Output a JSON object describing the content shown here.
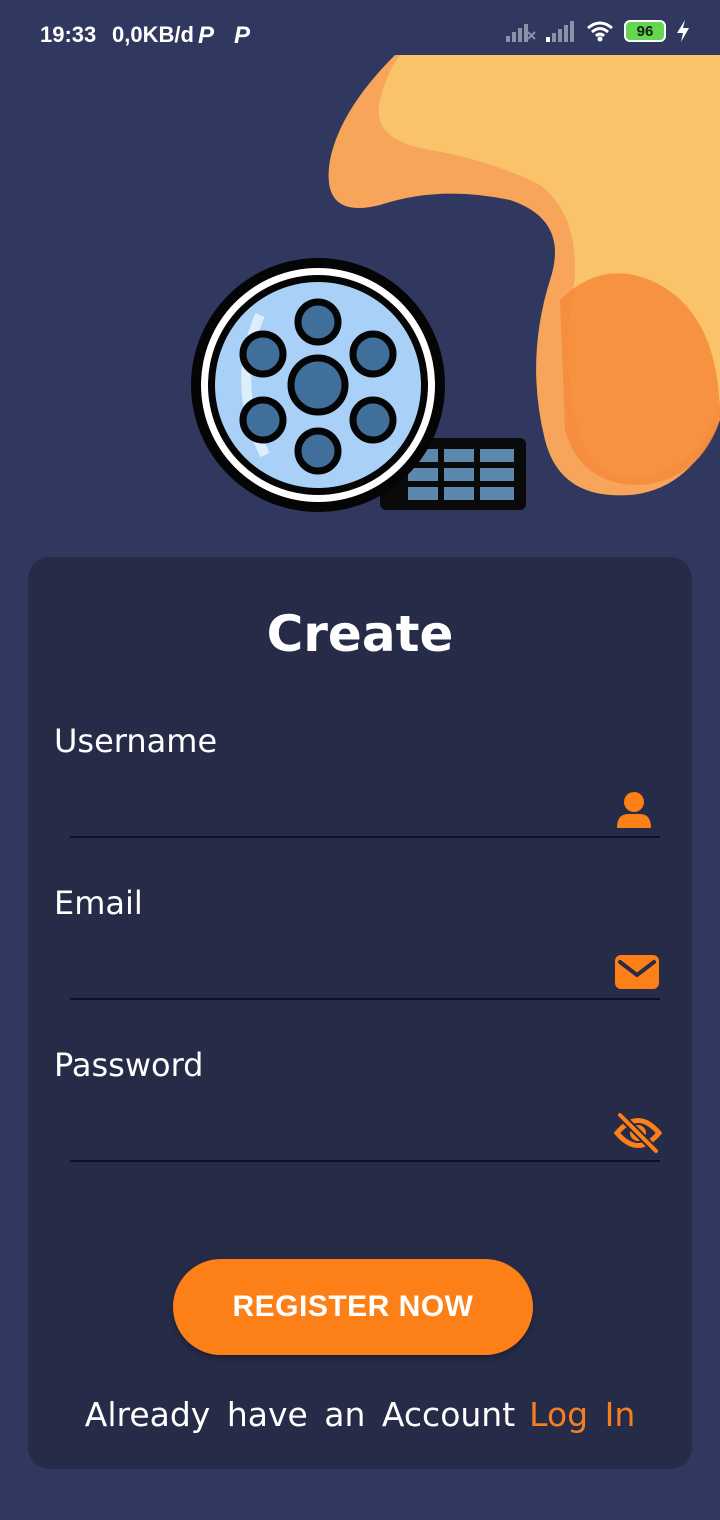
{
  "status_bar": {
    "time": "19:33",
    "data_speed": "0,0KB/d",
    "notification_icons": [
      "P",
      "P"
    ],
    "battery_level": "96"
  },
  "register_form": {
    "title": "Create",
    "fields": [
      {
        "label": "Username",
        "icon": "person-icon"
      },
      {
        "label": "Email",
        "icon": "mail-icon"
      },
      {
        "label": "Password",
        "icon": "eye-off-icon"
      }
    ],
    "submit_label": "REGISTER NOW",
    "footer_text": "Already have an Account",
    "login_link": "Log In"
  },
  "colors": {
    "background": "#30385f",
    "card": "#262b48",
    "accent": "#fd7f17",
    "blob_light": "#fbc76a",
    "blob_dark": "#f5893a"
  }
}
